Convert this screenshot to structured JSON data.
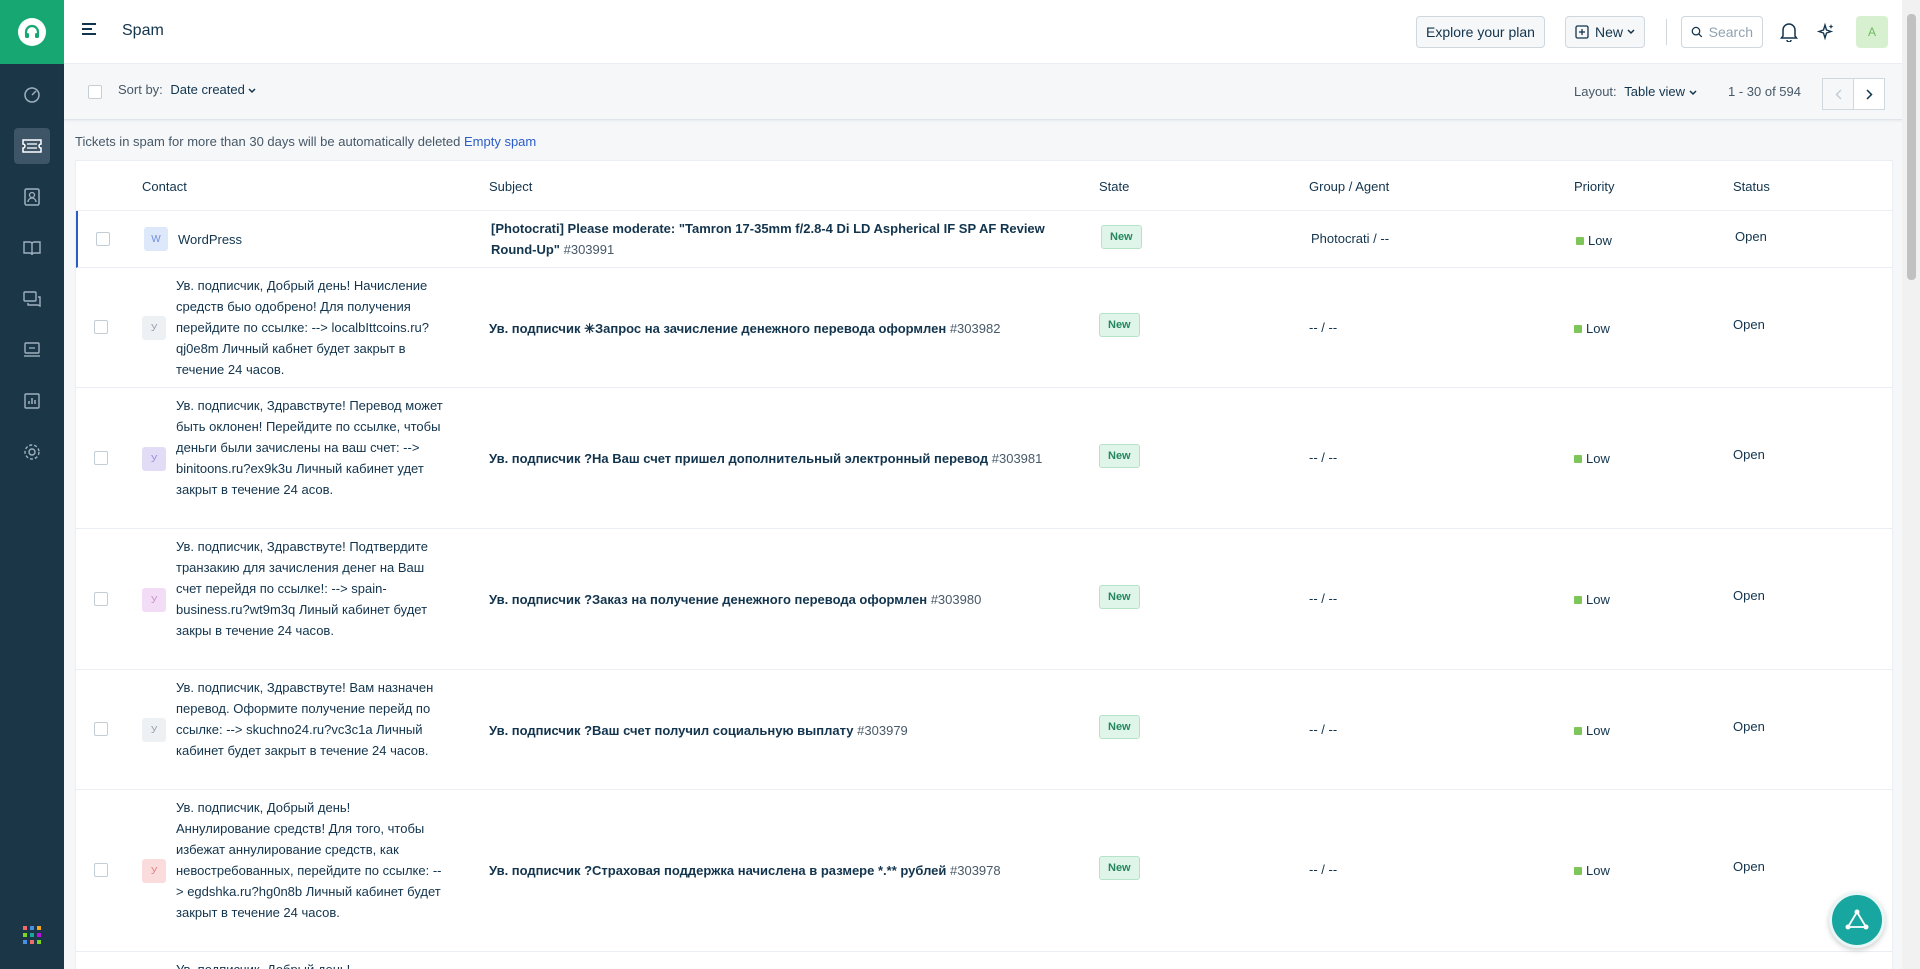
{
  "header": {
    "title": "Spam",
    "explore_label": "Explore your plan",
    "new_label": "New",
    "search_placeholder": "Search",
    "avatar_initial": "A"
  },
  "toolbar": {
    "sort_label": "Sort by:",
    "sort_value": "Date created",
    "layout_label": "Layout:",
    "layout_value": "Table view",
    "pagination": "1 - 30 of 594"
  },
  "info": {
    "text": "Tickets in spam for more than 30 days will be automatically deleted",
    "link": "Empty spam"
  },
  "table": {
    "headers": {
      "contact": "Contact",
      "subject": "Subject",
      "state": "State",
      "group": "Group / Agent",
      "priority": "Priority",
      "status": "Status"
    },
    "rows": [
      {
        "avatar": "W",
        "avatar_color": "#dde8fb",
        "contact": "WordPress",
        "subject": "[Photocrati] Please moderate: \"Tamron 17-35mm f/2.8-4 Di LD Aspherical IF SP AF Review Round-Up\"",
        "ticket_id": "#303991",
        "state": "New",
        "group": "Photocrati / --",
        "priority": "Low",
        "status": "Open"
      },
      {
        "avatar": "У",
        "avatar_color": "#eef1f4",
        "contact": "Ув. подписчик, Добрый день! Начисление средств быо одобрено! Для получения перейдите по ссылке: --> localbIttcoins.ru?qj0e8m Личный кабнет будет закрыт в течение 24 часов.",
        "subject": "Ув. подписчик ✳Запрос на зачисление денежного перевода оформлен",
        "ticket_id": "#303982",
        "state": "New",
        "group": "-- / --",
        "priority": "Low",
        "status": "Open"
      },
      {
        "avatar": "У",
        "avatar_color": "#e3dcf7",
        "contact": "Ув. подписчик, Здравствуте! Перевод может быть оклонен! Перейдите по ссылке, чтобы деньги были зачислены на ваш счет: --> binitoons.ru?ex9k3u Личный кабинет удет закрыт в течение 24 асов.",
        "subject": "Ув. подписчик ?На Ваш счет пришел дополнительный электронный перевод",
        "ticket_id": "#303981",
        "state": "New",
        "group": "-- / --",
        "priority": "Low",
        "status": "Open"
      },
      {
        "avatar": "У",
        "avatar_color": "#f3dcf5",
        "contact": "Ув. подписчик, Здравствуте! Подтвердите транзакию для зачисления денег на Ваш счет перейдя по ссылке!: --> spain-business.ru?wt9m3q Линый кабинет будет закры в течение 24 часов.",
        "subject": "Ув. подписчик ?Заказ на получение денежного перевода оформлен",
        "ticket_id": "#303980",
        "state": "New",
        "group": "-- / --",
        "priority": "Low",
        "status": "Open"
      },
      {
        "avatar": "У",
        "avatar_color": "#eef1f4",
        "contact": "Ув. подписчик, Здравствуте! Вам назначен перевод. Оформите получение перейд по ссылке: --> skuchno24.ru?vc3c1a Личный кабинет будет закрыт в течение 24 часов.",
        "subject": "Ув. подписчик ?Ваш счет получил социальную выплату",
        "ticket_id": "#303979",
        "state": "New",
        "group": "-- / --",
        "priority": "Low",
        "status": "Open"
      },
      {
        "avatar": "У",
        "avatar_color": "#fbdcdc",
        "contact": "Ув. подписчик, Добрый день! Аннулирование средств! Для того, чтобы избежат аннулирование средств, как невостребованных, перейдите по ссылке: --> egdshka.ru?hg0n8b Личный кабинет будет закрыт в течение 24 часов.",
        "subject": "Ув. подписчик ?Страховая поддержка начислена в размере *.** рублей",
        "ticket_id": "#303978",
        "state": "New",
        "group": "-- / --",
        "priority": "Low",
        "status": "Open"
      },
      {
        "avatar": "",
        "avatar_color": "#ffffff",
        "contact": "Ув. подписчик, Добрый день!",
        "subject": "",
        "ticket_id": "",
        "state": "",
        "group": "",
        "priority": "",
        "status": ""
      }
    ]
  },
  "colors": {
    "nav_bg": "#1b3647",
    "brand_green": "#17a772",
    "link_blue": "#2c5cc5",
    "state_new_bg": "#e0f5ea",
    "priority_low": "#7ec55a"
  },
  "icons": {
    "nav": [
      "dashboard-icon",
      "tickets-icon",
      "contacts-icon",
      "solutions-icon",
      "forums-icon",
      "assets-icon",
      "reports-icon",
      "admin-icon"
    ],
    "top": [
      "bell-icon",
      "sparkle-icon"
    ]
  }
}
